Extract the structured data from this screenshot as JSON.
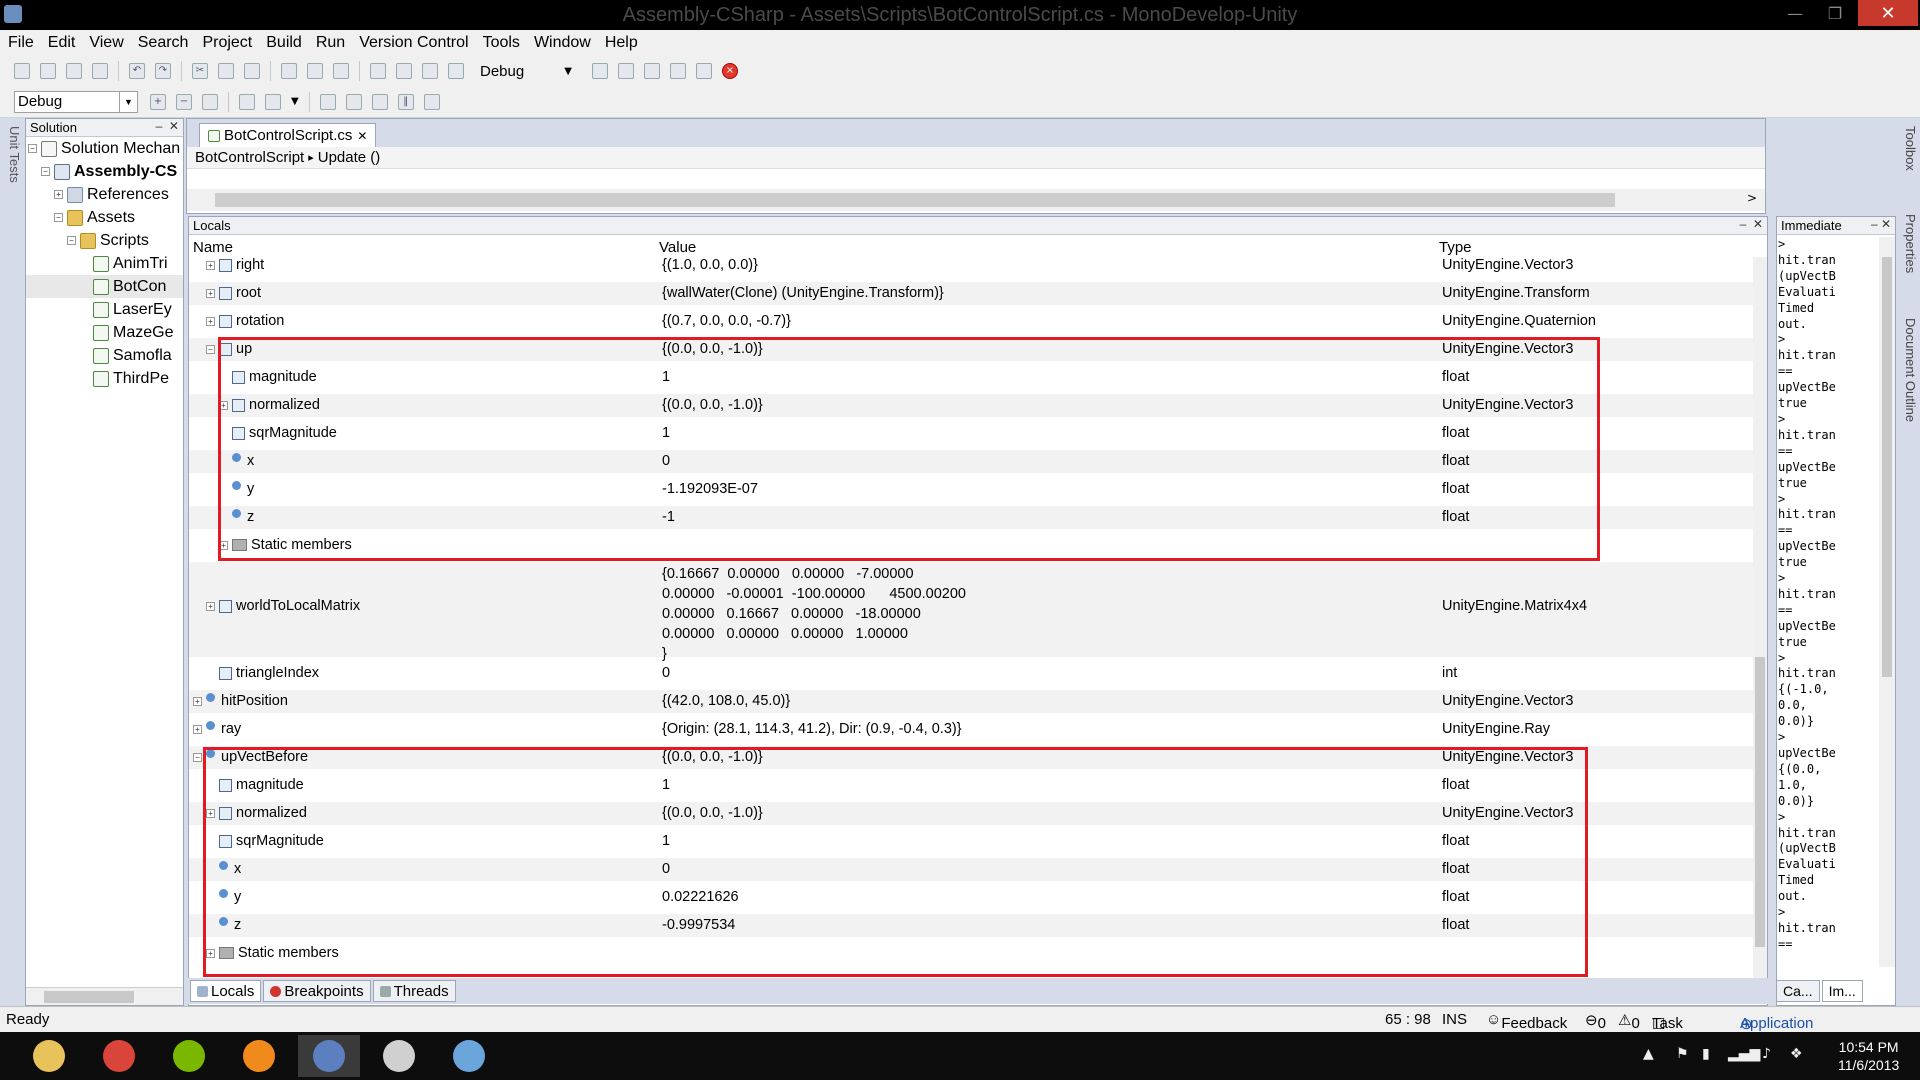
{
  "window": {
    "title": "Assembly-CSharp - Assets\\Scripts\\BotControlScript.cs - MonoDevelop-Unity",
    "minimize": "—",
    "maximize": "❐",
    "close": "✕"
  },
  "menu": [
    "File",
    "Edit",
    "View",
    "Search",
    "Project",
    "Build",
    "Run",
    "Version Control",
    "Tools",
    "Window",
    "Help"
  ],
  "toolbar": {
    "config_label": "Debug",
    "config_combo": "Debug"
  },
  "left_strip": {
    "unit_tests": "Unit Tests"
  },
  "solution": {
    "header": "Solution",
    "tree": [
      {
        "label": "Solution Mechan",
        "icon": "solution-icon",
        "depth": 0,
        "expander": "⊟",
        "bold": false
      },
      {
        "label": "Assembly-CS",
        "icon": "project-icon",
        "depth": 1,
        "expander": "⊟",
        "bold": true
      },
      {
        "label": "References",
        "icon": "references-icon",
        "depth": 2,
        "expander": "⊞",
        "bold": false
      },
      {
        "label": "Assets",
        "icon": "folder-icon",
        "depth": 2,
        "expander": "⊟",
        "bold": false
      },
      {
        "label": "Scripts",
        "icon": "folder-icon",
        "depth": 3,
        "expander": "⊟",
        "bold": false
      },
      {
        "label": "AnimTri",
        "icon": "csharp-file-icon",
        "depth": 4,
        "expander": "",
        "bold": false
      },
      {
        "label": "BotCon",
        "icon": "csharp-file-icon",
        "depth": 4,
        "expander": "",
        "bold": false,
        "selected": true
      },
      {
        "label": "LaserEy",
        "icon": "csharp-file-icon",
        "depth": 4,
        "expander": "",
        "bold": false
      },
      {
        "label": "MazeGe",
        "icon": "csharp-file-icon",
        "depth": 4,
        "expander": "",
        "bold": false
      },
      {
        "label": "Samofla",
        "icon": "csharp-file-icon",
        "depth": 4,
        "expander": "",
        "bold": false
      },
      {
        "label": "ThirdPe",
        "icon": "csharp-file-icon",
        "depth": 4,
        "expander": "",
        "bold": false
      }
    ]
  },
  "editor": {
    "tab_label": "BotControlScript.cs",
    "breadcrumb": [
      "BotControlScript",
      "Update ()"
    ]
  },
  "locals": {
    "header": "Locals",
    "columns": {
      "name": "Name",
      "value": "Value",
      "type": "Type"
    },
    "rows": [
      {
        "name": "right",
        "depth": 1,
        "expander": "⊞",
        "icon": "property-icon",
        "value": "{(1.0, 0.0, 0.0)}",
        "type": "UnityEngine.Vector3"
      },
      {
        "name": "root",
        "depth": 1,
        "expander": "⊞",
        "icon": "property-icon",
        "value": "{wallWater(Clone) (UnityEngine.Transform)}",
        "type": "UnityEngine.Transform"
      },
      {
        "name": "rotation",
        "depth": 1,
        "expander": "⊞",
        "icon": "property-icon",
        "value": "{(0.7, 0.0, 0.0, -0.7)}",
        "type": "UnityEngine.Quaternion"
      },
      {
        "name": "up",
        "depth": 1,
        "expander": "⊟",
        "icon": "property-icon",
        "value": "{(0.0, 0.0, -1.0)}",
        "type": "UnityEngine.Vector3"
      },
      {
        "name": "magnitude",
        "depth": 2,
        "expander": "",
        "icon": "property-icon",
        "value": "1",
        "type": "float"
      },
      {
        "name": "normalized",
        "depth": 2,
        "expander": "⊞",
        "icon": "property-icon",
        "value": "{(0.0, 0.0, -1.0)}",
        "type": "UnityEngine.Vector3"
      },
      {
        "name": "sqrMagnitude",
        "depth": 2,
        "expander": "",
        "icon": "property-icon",
        "value": "1",
        "type": "float"
      },
      {
        "name": "x",
        "depth": 2,
        "expander": "",
        "icon": "field-icon",
        "value": "0",
        "type": "float"
      },
      {
        "name": "y",
        "depth": 2,
        "expander": "",
        "icon": "field-icon",
        "value": "-1.192093E-07",
        "type": "float"
      },
      {
        "name": "z",
        "depth": 2,
        "expander": "",
        "icon": "field-icon",
        "value": "-1",
        "type": "float"
      },
      {
        "name": "Static members",
        "depth": 2,
        "expander": "⊞",
        "icon": "folder-icon",
        "value": "",
        "type": ""
      },
      {
        "name": "worldToLocalMatrix",
        "depth": 1,
        "expander": "⊞",
        "icon": "property-icon",
        "value": "{0.16667  0.00000   0.00000   -7.00000\n0.00000   -0.00001  -100.00000      4500.00200\n0.00000   0.16667   0.00000   -18.00000\n0.00000   0.00000   0.00000   1.00000\n}",
        "type": "UnityEngine.Matrix4x4",
        "tall": true
      },
      {
        "name": "triangleIndex",
        "depth": 1,
        "expander": "",
        "icon": "property-icon",
        "value": "0",
        "type": "int"
      },
      {
        "name": "hitPosition",
        "depth": 0,
        "expander": "⊞",
        "icon": "field-icon",
        "value": "{(42.0, 108.0, 45.0)}",
        "type": "UnityEngine.Vector3"
      },
      {
        "name": "ray",
        "depth": 0,
        "expander": "⊞",
        "icon": "field-icon",
        "value": "{Origin: (28.1, 114.3, 41.2), Dir: (0.9, -0.4, 0.3)}",
        "type": "UnityEngine.Ray"
      },
      {
        "name": "upVectBefore",
        "depth": 0,
        "expander": "⊟",
        "icon": "field-icon",
        "value": "{(0.0, 0.0, -1.0)}",
        "type": "UnityEngine.Vector3"
      },
      {
        "name": "magnitude",
        "depth": 1,
        "expander": "",
        "icon": "property-icon",
        "value": "1",
        "type": "float"
      },
      {
        "name": "normalized",
        "depth": 1,
        "expander": "⊞",
        "icon": "property-icon",
        "value": "{(0.0, 0.0, -1.0)}",
        "type": "UnityEngine.Vector3"
      },
      {
        "name": "sqrMagnitude",
        "depth": 1,
        "expander": "",
        "icon": "property-icon",
        "value": "1",
        "type": "float"
      },
      {
        "name": "x",
        "depth": 1,
        "expander": "",
        "icon": "field-icon",
        "value": "0",
        "type": "float"
      },
      {
        "name": "y",
        "depth": 1,
        "expander": "",
        "icon": "field-icon",
        "value": "0.02221626",
        "type": "float"
      },
      {
        "name": "z",
        "depth": 1,
        "expander": "",
        "icon": "field-icon",
        "value": "-0.9997534",
        "type": "float"
      },
      {
        "name": "Static members",
        "depth": 1,
        "expander": "⊞",
        "icon": "folder-icon",
        "value": "",
        "type": ""
      }
    ]
  },
  "highlight_color": "#e01b24",
  "bottom_tabs": [
    "Locals",
    "Breakpoints",
    "Threads"
  ],
  "immediate": {
    "header": "Immediate",
    "text": ">\nhit.tran\n(upVectB\nEvaluati\nTimed\nout.\n>\nhit.tran\n==\nupVectBe\ntrue\n>\nhit.tran\n==\nupVectBe\ntrue\n>\nhit.tran\n==\nupVectBe\ntrue\n>\nhit.tran\n==\nupVectBe\ntrue\n>\nhit.tran\n{(-1.0,\n0.0,\n0.0)}\n>\nupVectBe\n{(0.0,\n1.0,\n0.0)}\n>\nhit.tran\n(upVectB\nEvaluati\nTimed\nout.\n>\nhit.tran\n==",
    "tabs": [
      "Ca...",
      "Im..."
    ]
  },
  "right_strip": [
    "Toolbox",
    "Properties",
    "Document Outline"
  ],
  "status": {
    "ready": "Ready",
    "position": "65 : 98",
    "mode": "INS",
    "feedback": "Feedback",
    "errors": "0",
    "warnings": "0",
    "task_list": "Task List",
    "app_output": "Application Output"
  },
  "taskbar": {
    "apps": [
      {
        "name": "file-explorer-icon",
        "color": "#e8c25a"
      },
      {
        "name": "chrome-icon",
        "color": "#d9453a"
      },
      {
        "name": "spotify-icon",
        "color": "#7ab800"
      },
      {
        "name": "tool-app-icon",
        "color": "#f08a1c"
      },
      {
        "name": "monodevelop-icon",
        "color": "#5c7fbf",
        "active": true
      },
      {
        "name": "unity-icon",
        "color": "#d0d0d0"
      },
      {
        "name": "paint-icon",
        "color": "#6aa5dc"
      }
    ],
    "time": "10:54 PM",
    "date": "11/6/2013"
  }
}
